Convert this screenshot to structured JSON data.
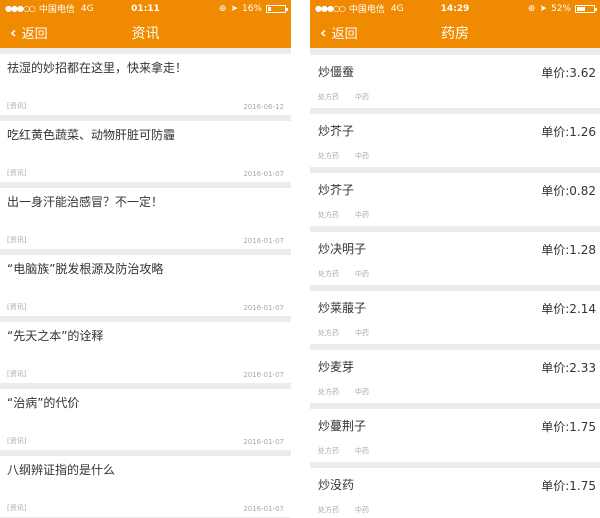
{
  "left": {
    "status": {
      "carrier": "中国电信",
      "network": "4G",
      "time": "01:11",
      "battery": "16%",
      "battery_level": 0.16
    },
    "nav": {
      "back": "返回",
      "title": "资讯"
    },
    "items": [
      {
        "title": "祛湿的妙招都在这里，快来拿走！",
        "tag": "[资讯]",
        "date": "2016-06-12"
      },
      {
        "title": "吃红黄色蔬菜、动物肝脏可防霾",
        "tag": "[资讯]",
        "date": "2016-01-07"
      },
      {
        "title": "出一身汗能治感冒？不一定！",
        "tag": "[资讯]",
        "date": "2016-01-07"
      },
      {
        "title": "“电脑族”脱发根源及防治攻略",
        "tag": "[资讯]",
        "date": "2016-01-07"
      },
      {
        "title": "“先天之本”的诠释",
        "tag": "[资讯]",
        "date": "2016-01-07"
      },
      {
        "title": "“治病”的代价",
        "tag": "[资讯]",
        "date": "2016-01-07"
      },
      {
        "title": "八纲辨证指的是什么",
        "tag": "[资讯]",
        "date": "2016-01-07"
      }
    ]
  },
  "right": {
    "status": {
      "carrier": "中国电信",
      "network": "4G",
      "time": "14:29",
      "battery": "52%",
      "battery_level": 0.52
    },
    "nav": {
      "back": "返回",
      "title": "药房"
    },
    "items": [
      {
        "name": "炒僵蚕",
        "price": "单价:3.62",
        "tag1": "处方药",
        "tag2": "中药"
      },
      {
        "name": "炒芥子",
        "price": "单价:1.26",
        "tag1": "处方药",
        "tag2": "中药"
      },
      {
        "name": "炒芥子",
        "price": "单价:0.82",
        "tag1": "处方药",
        "tag2": "中药"
      },
      {
        "name": "炒决明子",
        "price": "单价:1.28",
        "tag1": "处方药",
        "tag2": "中药"
      },
      {
        "name": "炒莱菔子",
        "price": "单价:2.14",
        "tag1": "处方药",
        "tag2": "中药"
      },
      {
        "name": "炒麦芽",
        "price": "单价:2.33",
        "tag1": "处方药",
        "tag2": "中药"
      },
      {
        "name": "炒蔓荆子",
        "price": "单价:1.75",
        "tag1": "处方药",
        "tag2": "中药"
      },
      {
        "name": "炒没药",
        "price": "单价:1.75",
        "tag1": "处方药",
        "tag2": "中药"
      }
    ]
  }
}
